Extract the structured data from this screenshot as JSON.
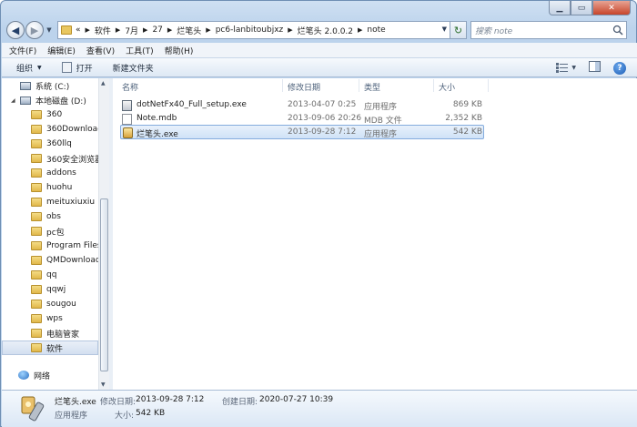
{
  "window": {
    "caption_buttons": [
      "minimize",
      "maximize",
      "close"
    ]
  },
  "nav": {
    "back_icon": "back-arrow-icon",
    "forward_icon": "forward-arrow-icon",
    "overflow": "«",
    "breadcrumbs": [
      "软件",
      "7月",
      "27",
      "烂笔头",
      "pc6-lanbitoubjxz",
      "烂笔头 2.0.0.2",
      "note"
    ],
    "search_placeholder": "搜索 note"
  },
  "menubar": {
    "items": [
      "文件(F)",
      "编辑(E)",
      "查看(V)",
      "工具(T)",
      "帮助(H)"
    ]
  },
  "toolbar": {
    "organize": "组织",
    "open": "打开",
    "new_folder": "新建文件夹"
  },
  "sidebar": {
    "items": [
      {
        "label": "系统 (C:)",
        "kind": "drive",
        "level": 1
      },
      {
        "label": "本地磁盘 (D:)",
        "kind": "drive",
        "level": 1,
        "expanded": true
      },
      {
        "label": "360",
        "kind": "folder",
        "level": 2
      },
      {
        "label": "360Downloads",
        "kind": "folder",
        "level": 2
      },
      {
        "label": "360llq",
        "kind": "folder",
        "level": 2
      },
      {
        "label": "360安全浏览器",
        "kind": "folder",
        "level": 2
      },
      {
        "label": "addons",
        "kind": "folder",
        "level": 2
      },
      {
        "label": "huohu",
        "kind": "folder",
        "level": 2
      },
      {
        "label": "meituxiuxiu",
        "kind": "folder",
        "level": 2
      },
      {
        "label": "obs",
        "kind": "folder",
        "level": 2
      },
      {
        "label": "pc包",
        "kind": "folder",
        "level": 2
      },
      {
        "label": "Program Files",
        "kind": "folder",
        "level": 2
      },
      {
        "label": "QMDownload",
        "kind": "folder",
        "level": 2
      },
      {
        "label": "qq",
        "kind": "folder",
        "level": 2
      },
      {
        "label": "qqwj",
        "kind": "folder",
        "level": 2
      },
      {
        "label": "sougou",
        "kind": "folder",
        "level": 2
      },
      {
        "label": "wps",
        "kind": "folder",
        "level": 2
      },
      {
        "label": "电脑管家",
        "kind": "folder",
        "level": 2
      },
      {
        "label": "软件",
        "kind": "folder",
        "level": 2,
        "selected": true
      }
    ],
    "network": "网络"
  },
  "file_list": {
    "columns": [
      "名称",
      "修改日期",
      "类型",
      "大小"
    ],
    "rows": [
      {
        "name": "dotNetFx40_Full_setup.exe",
        "modified": "2013-04-07 0:25",
        "type": "应用程序",
        "size": "869 KB",
        "icon": "exe-installer-icon"
      },
      {
        "name": "Note.mdb",
        "modified": "2013-09-06 20:26",
        "type": "MDB 文件",
        "size": "2,352 KB",
        "icon": "mdb-file-icon"
      },
      {
        "name": "烂笔头.exe",
        "modified": "2013-09-28 7:12",
        "type": "应用程序",
        "size": "542 KB",
        "icon": "app-exe-icon",
        "selected": true
      }
    ]
  },
  "details": {
    "name": "烂笔头.exe",
    "kind": "应用程序",
    "modified_label": "修改日期:",
    "modified": "2013-09-28 7:12",
    "created_label": "创建日期:",
    "created": "2020-07-27 10:39",
    "size_label": "大小:",
    "size": "542 KB"
  }
}
